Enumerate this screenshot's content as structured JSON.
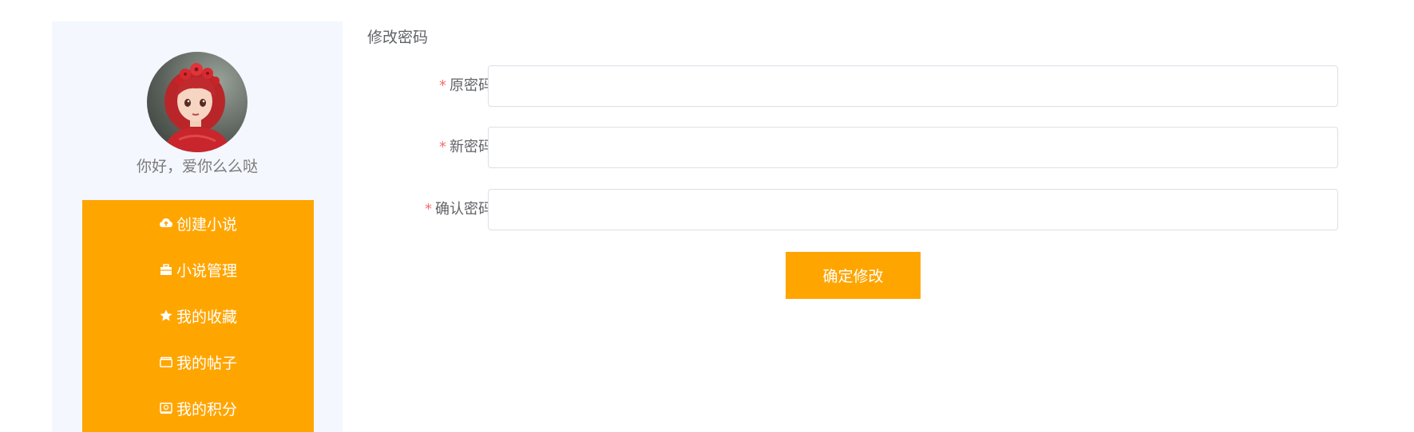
{
  "sidebar": {
    "greeting": "你好，爱你么么哒",
    "menu": [
      {
        "icon": "cloud-upload-icon",
        "label": "创建小说"
      },
      {
        "icon": "briefcase-icon",
        "label": "小说管理"
      },
      {
        "icon": "star-icon",
        "label": "我的收藏"
      },
      {
        "icon": "folder-icon",
        "label": "我的帖子"
      },
      {
        "icon": "wallet-icon",
        "label": "我的积分"
      }
    ]
  },
  "form": {
    "title": "修改密码",
    "required_mark": "*",
    "fields": [
      {
        "label": "原密码",
        "value": ""
      },
      {
        "label": "新密码",
        "value": ""
      },
      {
        "label": "确认密码",
        "value": ""
      }
    ],
    "submit_label": "确定修改"
  },
  "colors": {
    "accent": "#ffa500",
    "sidebar_bg": "#f4f7fe",
    "required": "#f56c6c",
    "text": "#606266"
  }
}
